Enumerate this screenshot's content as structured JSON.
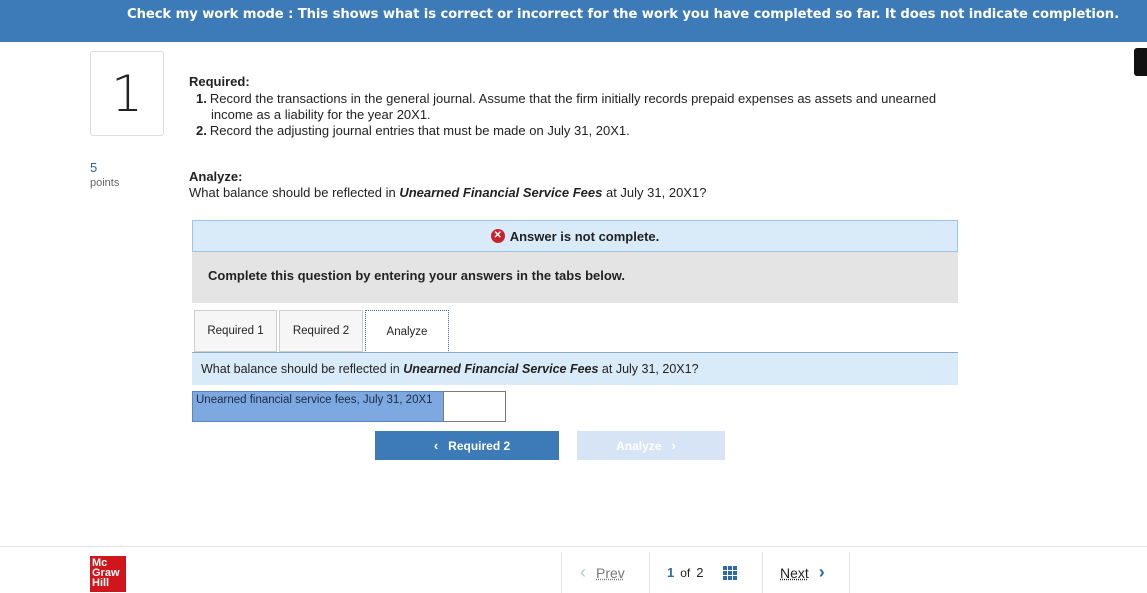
{
  "banner": {
    "text": "Check my work mode : This shows what is correct or incorrect for the work you have completed so far. It does not indicate completion."
  },
  "question": {
    "number": "1",
    "points_value": "5",
    "points_label": "points"
  },
  "required": {
    "heading": "Required:",
    "items": [
      {
        "num": "1.",
        "line1": "Record the transactions in the general journal. Assume that the firm initially records prepaid expenses as assets and unearned",
        "line2": "income as a liability for the year 20X1."
      },
      {
        "num": "2.",
        "line1": "Record the adjusting journal entries that must be made on July 31, 20X1."
      }
    ]
  },
  "analyze": {
    "title": "Analyze:",
    "question_pre": "What balance should be reflected in ",
    "question_em": "Unearned Financial Service Fees",
    "question_post": " at July 31, 20X1?"
  },
  "status": {
    "icon": "error-x-icon",
    "text": "Answer is not complete."
  },
  "instructions": "Complete this question by entering your answers in the tabs below.",
  "tabs": [
    {
      "label": "Required 1",
      "active": false
    },
    {
      "label": "Required 2",
      "active": false
    },
    {
      "label": "Analyze",
      "active": true
    }
  ],
  "tab_panel": {
    "question_pre": "What balance should be reflected in ",
    "question_em": "Unearned Financial Service Fees",
    "question_post": " at July 31, 20X1?",
    "field_label": "Unearned financial service fees, July 31, 20X1",
    "field_value": ""
  },
  "buttons": {
    "prev_label": "Required 2",
    "next_label": "Analyze"
  },
  "footer": {
    "logo_text": "Mc Graw Hill",
    "prev": "Prev",
    "page_current": "1",
    "page_of": "of",
    "page_total": "2",
    "next": "Next"
  },
  "colors": {
    "banner": "#3d7ab8",
    "error": "#c8232c",
    "logo": "#d0161c",
    "link": "#2e6aa8"
  }
}
